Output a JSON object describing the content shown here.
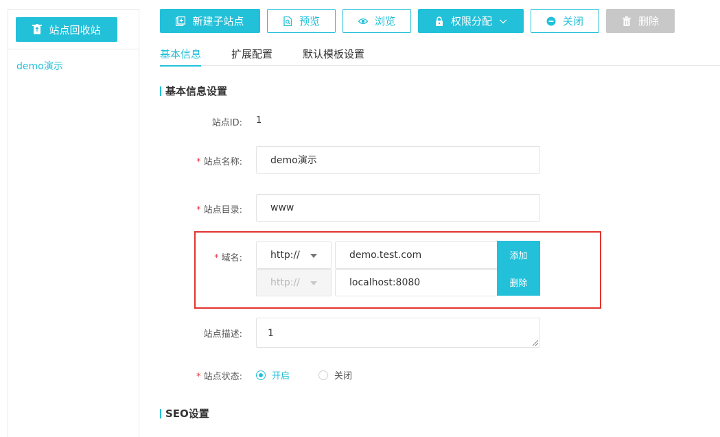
{
  "sidebar": {
    "recycle_label": "站点回收站",
    "sites": [
      "demo演示"
    ]
  },
  "toolbar": {
    "new_site": "新建子站点",
    "preview": "预览",
    "browse": "浏览",
    "permissions": "权限分配",
    "close": "关闭",
    "delete": "删除"
  },
  "tabs": [
    "基本信息",
    "扩展配置",
    "默认模板设置"
  ],
  "sections": {
    "basic": "基本信息设置",
    "seo": "SEO设置"
  },
  "form": {
    "site_id_label": "站点ID:",
    "site_id_value": "1",
    "site_name_label": "站点名称:",
    "site_name_value": "demo演示",
    "site_dir_label": "站点目录:",
    "site_dir_value": "www",
    "domain_label": "域名:",
    "domains": [
      {
        "protocol": "http://",
        "host": "demo.test.com",
        "action": "添加"
      },
      {
        "protocol": "http://",
        "host": "localhost:8080",
        "action": "删除"
      }
    ],
    "desc_label": "站点描述:",
    "desc_value": "1",
    "status_label": "站点状态:",
    "status_on": "开启",
    "status_off": "关闭",
    "required_mark": "*"
  },
  "colors": {
    "accent": "#22c0d9",
    "disabled": "#c8c8c8",
    "highlight": "#e2322d",
    "required": "#e4393c"
  }
}
